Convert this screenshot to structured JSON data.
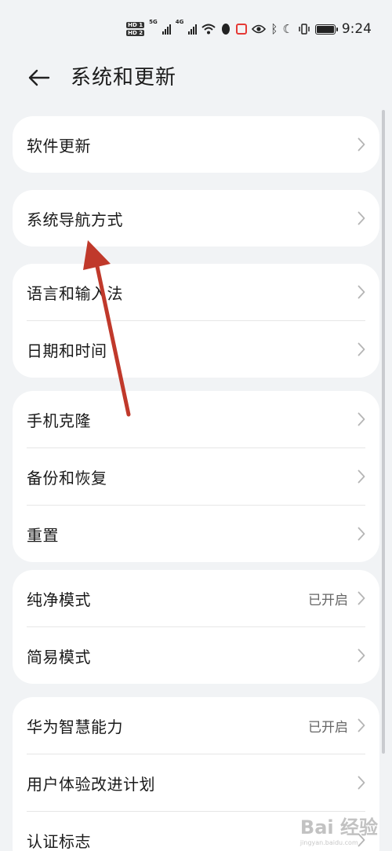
{
  "status_bar": {
    "hd1": "HD 1",
    "hd2": "HD 2",
    "net1": "5G",
    "net2": "4G",
    "time": "9:24"
  },
  "header": {
    "title": "系统和更新"
  },
  "groups": [
    {
      "items": [
        {
          "label": "软件更新",
          "value": ""
        }
      ]
    },
    {
      "items": [
        {
          "label": "系统导航方式",
          "value": ""
        }
      ]
    },
    {
      "items": [
        {
          "label": "语言和输入法",
          "value": ""
        },
        {
          "label": "日期和时间",
          "value": ""
        }
      ]
    },
    {
      "items": [
        {
          "label": "手机克隆",
          "value": ""
        },
        {
          "label": "备份和恢复",
          "value": ""
        },
        {
          "label": "重置",
          "value": ""
        }
      ]
    },
    {
      "items": [
        {
          "label": "纯净模式",
          "value": "已开启"
        },
        {
          "label": "简易模式",
          "value": ""
        }
      ]
    },
    {
      "items": [
        {
          "label": "华为智慧能力",
          "value": "已开启"
        },
        {
          "label": "用户体验改进计划",
          "value": ""
        },
        {
          "label": "认证标志",
          "value": ""
        }
      ]
    }
  ],
  "watermark": {
    "text": "Bai 经验",
    "sub": "jingyan.baidu.com"
  },
  "colors": {
    "background": "#f1f3f5",
    "card": "#ffffff",
    "annotation_arrow": "#c0392b",
    "recording_indicator": "#e53935"
  }
}
